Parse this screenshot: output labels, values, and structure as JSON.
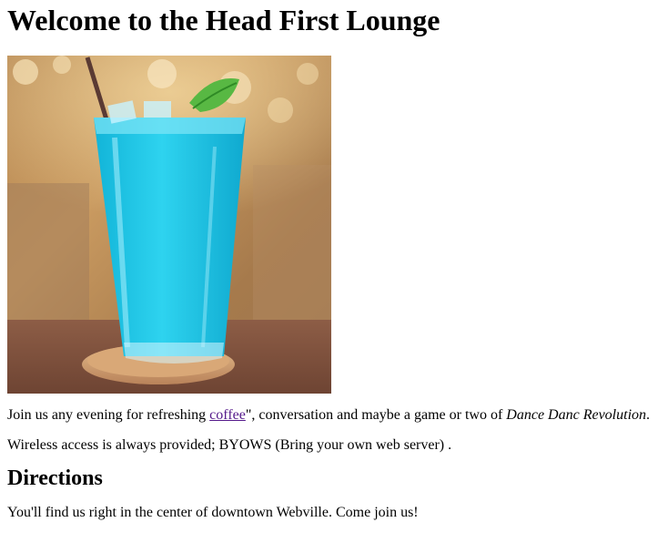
{
  "page": {
    "title": "Welcome to the Head First Lounge"
  },
  "intro": {
    "before_link": "Join us any evening for refreshing ",
    "link_text": "coffee",
    "after_link": "\", conversation and maybe a game or two of ",
    "game_title": "Dance Danc Revolution",
    "end": "."
  },
  "wireless": {
    "text": "Wireless access is always provided; BYOWS (Bring your own web server) ."
  },
  "directions": {
    "heading": "Directions",
    "text": "You'll find us right in the center of downtown Webville. Come join us!"
  },
  "colors": {
    "link_visited": "#551a8b",
    "drink": "#1ec6e6"
  }
}
